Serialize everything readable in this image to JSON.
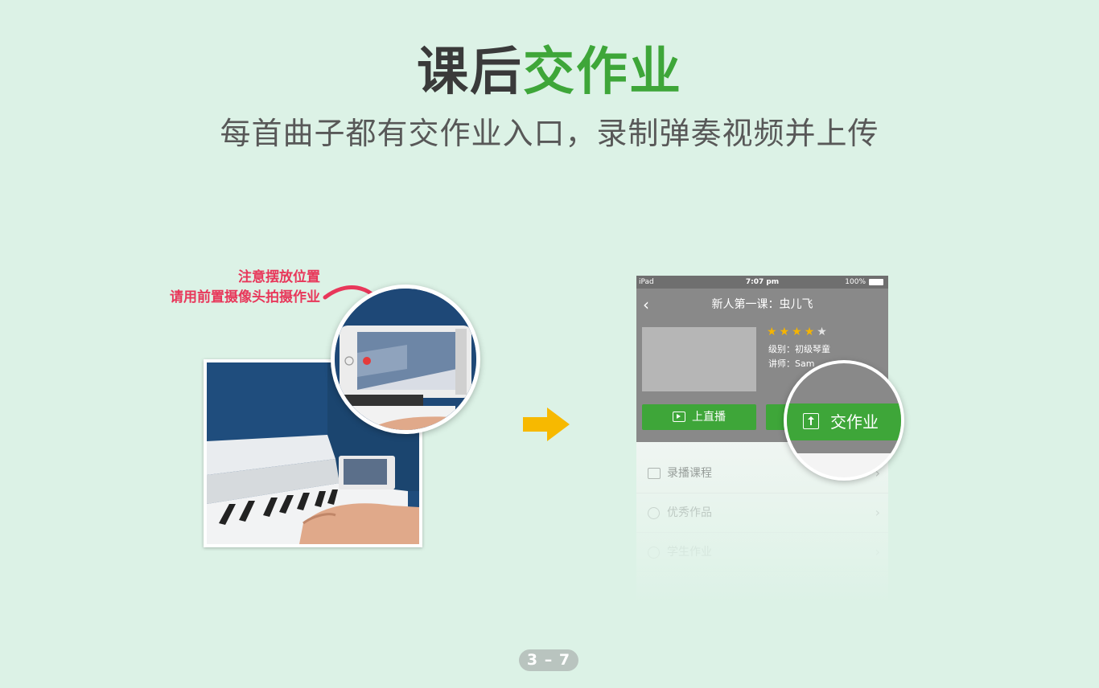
{
  "title": {
    "part1": "课后",
    "part2": "交作业",
    "subtitle": "每首曲子都有交作业入口，录制弹奏视频并上传"
  },
  "annotation": {
    "line1": "注意摆放位置",
    "line2": "请用前置摄像头拍摄作业"
  },
  "ipad": {
    "status": {
      "device": "iPad",
      "time": "7:07 pm",
      "battery": "100%"
    },
    "nav_title": "新人第一课：虫儿飞",
    "rating": {
      "value": 4,
      "max": 5
    },
    "level": "级别：初级琴童",
    "teacher": "讲师：Sam",
    "live_button": "上直播",
    "homework_button": "交作业",
    "list": [
      {
        "label": "录播课程",
        "icon": "video-icon"
      },
      {
        "label": "优秀作品",
        "icon": "medal-icon"
      },
      {
        "label": "学生作业",
        "icon": "circle-icon"
      }
    ]
  },
  "page_number": "3 – 7",
  "colors": {
    "background": "#dcf2e6",
    "accent_green": "#3ea639",
    "annotation_red": "#e8375a",
    "arrow_yellow": "#f7b900",
    "header_gray": "#898989"
  }
}
